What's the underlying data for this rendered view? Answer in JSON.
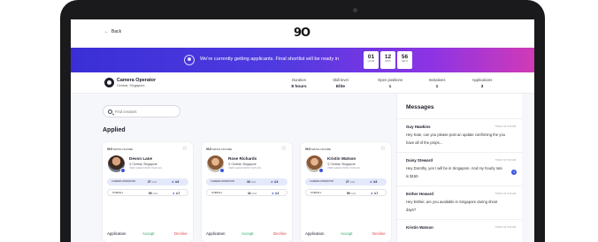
{
  "topbar": {
    "back_label": "Back",
    "logo": "9O"
  },
  "banner": {
    "text": "We're currently getting applicants. Final shortlist will be ready in",
    "timer": [
      {
        "value": "01",
        "unit": "HOUR"
      },
      {
        "value": "12",
        "unit": "MINS"
      },
      {
        "value": "56",
        "unit": "SECS"
      }
    ]
  },
  "job": {
    "title": "Camera Operator",
    "location": "Central, Singapore",
    "stats": [
      {
        "label": "Duration",
        "value": "8 hours"
      },
      {
        "label": "Skill level",
        "value": "Elite"
      },
      {
        "label": "Open positions",
        "value": "1"
      },
      {
        "label": "Invitations",
        "value": "1"
      },
      {
        "label": "Applications",
        "value": "3"
      }
    ]
  },
  "search": {
    "placeholder": "Find creators"
  },
  "applied_title": "Applied",
  "cards": [
    {
      "match": "99.5",
      "match_label": "MATCH SCORE",
      "name": "Devon Lane",
      "location": "Central, Singapore",
      "link": "VIEW GEAR FROM THIS GIG",
      "role_label": "CAMERA OPERATOR",
      "role_gigs": "27",
      "role_rating": "4.6",
      "overall_label": "OVERALL",
      "overall_gigs": "59",
      "overall_rating": "4.7",
      "gigs_unit": "GIGS"
    },
    {
      "match": "99.5",
      "match_label": "MATCH SCORE",
      "name": "Rose Richards",
      "location": "Central, Singapore",
      "link": "VIEW GEAR FROM THIS GIG",
      "role_label": "CAMERA OPERATOR",
      "role_gigs": "16",
      "role_rating": "4.3",
      "overall_label": "OVERALL",
      "overall_gigs": "34",
      "overall_rating": "4.3",
      "gigs_unit": "GIGS"
    },
    {
      "match": "99.5",
      "match_label": "MATCH SCORE",
      "name": "Kristin Watson",
      "location": "Central, Singapore",
      "link": "VIEW GEAR FROM THIS GIG",
      "role_label": "CAMERA OPERATOR",
      "role_gigs": "27",
      "role_rating": "4.6",
      "overall_label": "OVERALL",
      "overall_gigs": "59",
      "overall_rating": "4.7",
      "gigs_unit": "GIGS"
    }
  ],
  "card_actions": {
    "application": "Application",
    "accept": "Accept",
    "decline": "Decline"
  },
  "messages": {
    "title": "Messages",
    "items": [
      {
        "name": "Guy Hawkins",
        "time": "TODAY AT 9:30 AM",
        "text": "Hey Kate, can you please post an update confirming the you have all of the props...",
        "unread": ""
      },
      {
        "name": "Daisy Steward",
        "time": "TODAY AT 9:30 AM",
        "text": "Hey Dorothy, yes I will be in Singapore. And my hourly rate is $150.",
        "unread": "4"
      },
      {
        "name": "Esther Howard",
        "time": "TODAY AT 9:30 AM",
        "text": "Hey Esther, are you available in Singapore during shoot days?",
        "unread": ""
      },
      {
        "name": "Kristin Watson",
        "time": "TODAY AT 9:30 AM",
        "text": "",
        "unread": ""
      }
    ]
  },
  "colors": {
    "accent": "#3a55e0",
    "accept": "#2aa56a",
    "decline": "#e0434b",
    "banner_start": "#3a2fd6",
    "banner_end": "#d13ab6"
  }
}
